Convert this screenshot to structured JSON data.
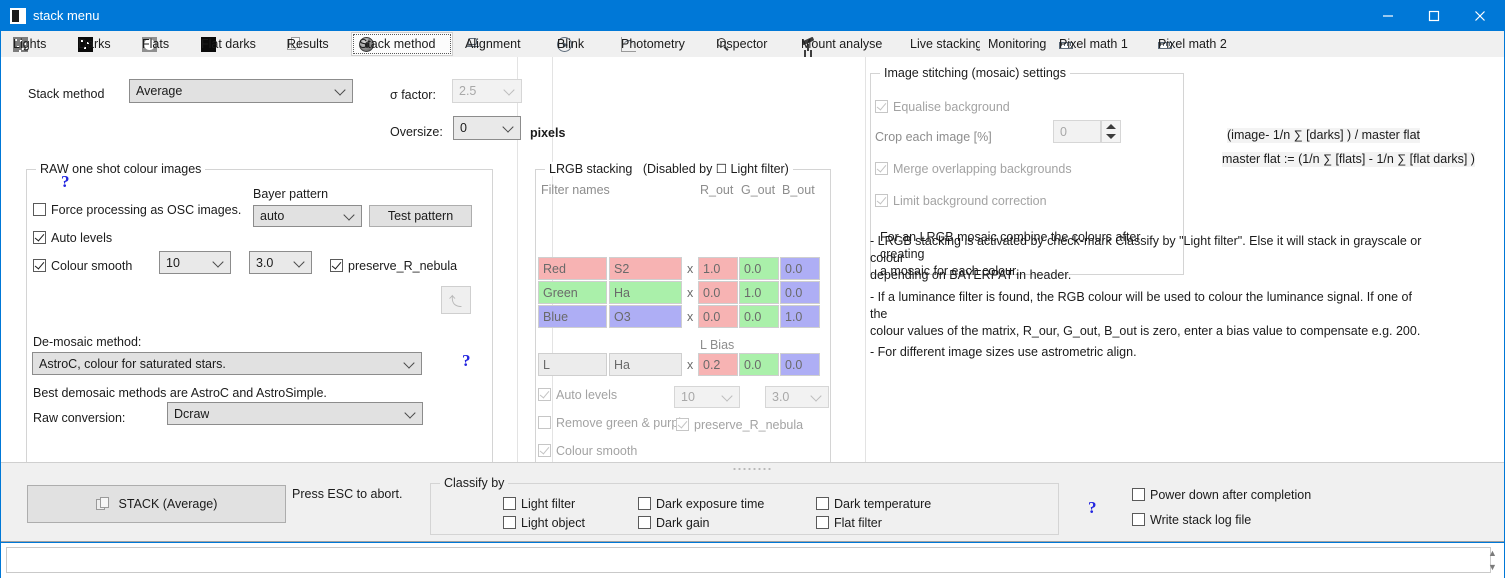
{
  "window": {
    "title": "stack menu",
    "minimize_label": "Minimize",
    "maximize_label": "Maximize",
    "close_label": "Close",
    "accent_color": "#0078d7"
  },
  "tabs": [
    {
      "label": "Lights",
      "icon": "lights-icon",
      "selected": false
    },
    {
      "label": "Darks",
      "icon": "darks-icon",
      "selected": false
    },
    {
      "label": "Flats",
      "icon": "flats-icon",
      "selected": false
    },
    {
      "label": "Flat darks",
      "icon": "flat-darks-icon",
      "selected": false
    },
    {
      "label": "Results",
      "icon": "results-icon",
      "selected": false
    },
    {
      "label": "Stack method",
      "icon": "stack-method-icon",
      "selected": true
    },
    {
      "label": "Alignment",
      "icon": "alignment-icon",
      "selected": false
    },
    {
      "label": "Blink",
      "icon": "blink-icon",
      "selected": false
    },
    {
      "label": "Photometry",
      "icon": "photometry-icon",
      "selected": false
    },
    {
      "label": "Inspector",
      "icon": "inspector-icon",
      "selected": false
    },
    {
      "label": "Mount analyse",
      "icon": "mount-analyse-icon",
      "selected": false
    },
    {
      "label": "Live stacking",
      "icon": "",
      "selected": false
    },
    {
      "label": "Monitoring",
      "icon": "",
      "selected": false
    },
    {
      "label": "Pixel math 1",
      "icon": "pixel-math-icon",
      "selected": false
    },
    {
      "label": "Pixel math 2",
      "icon": "pixel-math-icon",
      "selected": false
    }
  ],
  "stack_method": {
    "label": "Stack method",
    "value": "Average",
    "help": "?",
    "sigma_label": "σ factor:",
    "sigma_value": "2.5",
    "oversize_label": "Oversize:",
    "oversize_value": "0",
    "pixels_label": "pixels"
  },
  "raw_osc": {
    "title": "RAW one shot colour images",
    "force_osc_label": "Force processing as OSC images.",
    "force_osc_checked": false,
    "auto_levels_label": "Auto levels",
    "auto_levels_checked": true,
    "colour_smooth_label": "Colour smooth",
    "colour_smooth_checked": true,
    "colour_smooth_value1": "10",
    "colour_smooth_value2": "3.0",
    "preserve_label": "preserve_R_nebula",
    "preserve_checked": true,
    "bayer_label": "Bayer pattern",
    "bayer_value": "auto",
    "test_pattern_label": "Test pattern",
    "undo_label": "Undo",
    "demosaic_label": "De-mosaic method:",
    "demosaic_value": "AstroC, colour for saturated stars.",
    "demosaic_help": "?",
    "demosaic_note": "Best demosaic methods are AstroC and AstroSimple.",
    "raw_conversion_label": "Raw conversion:",
    "raw_conversion_value": "Dcraw"
  },
  "lrgb": {
    "title": "LRGB stacking",
    "title_suffix": "(Disabled by ☐ Light filter)",
    "filter_names_label": "Filter names",
    "col_r": "R_out",
    "col_g": "G_out",
    "col_b": "B_out",
    "x_symbol": "x",
    "l_bias_label": "L Bias",
    "rows": [
      {
        "name": "Red",
        "filter": "S2",
        "r": "1.0",
        "g": "0.0",
        "b": "0.0",
        "tone": "red"
      },
      {
        "name": "Green",
        "filter": "Ha",
        "r": "0.0",
        "g": "1.0",
        "b": "0.0",
        "tone": "green"
      },
      {
        "name": "Blue",
        "filter": "O3",
        "r": "0.0",
        "g": "0.0",
        "b": "1.0",
        "tone": "blue"
      }
    ],
    "l_row": {
      "name": "L",
      "filter": "Ha",
      "r": "0.2",
      "g": "0.0",
      "b": "0.0",
      "tone": "plain"
    },
    "auto_levels_label": "Auto levels",
    "auto_levels_checked": true,
    "remove_gp_label": "Remove green & purple",
    "remove_gp_checked": false,
    "colour_smooth_label": "Colour smooth",
    "colour_smooth_checked": true,
    "colour_smooth_value1": "10",
    "colour_smooth_value2": "3.0",
    "preserve_label": "preserve_R_nebula",
    "preserve_checked": true
  },
  "mosaic": {
    "title": "Image stitching (mosaic) settings",
    "equalise_label": "Equalise background",
    "equalise_checked": true,
    "crop_label": "Crop each image [%]",
    "crop_value": "0",
    "merge_label": "Merge overlapping backgrounds",
    "merge_checked": true,
    "limit_label": "Limit background correction",
    "limit_checked": true,
    "note": "For an LRGB mosaic combine the colours after creating\na mosaic for each colour."
  },
  "formulas": {
    "line1": "(image- 1/n ∑ [darks] ) / master flat",
    "line2": "master flat :=  (1/n ∑ [flats] - 1/n ∑ [flat darks] )"
  },
  "notes": {
    "bullet1": "- LRGB stacking is activated by check-mark Classify by \"Light filter\". Else it will stack in grayscale or colour\ndepending on BAYERPAT in header.",
    "bullet2": "- If a luminance filter is found, the RGB colour will be used to colour the luminance signal. If one of the\ncolour values of the matrix, R_our, G_out, B_out is zero, enter a bias value to compensate e.g. 200.",
    "bullet3": "- For different image sizes use astrometric align."
  },
  "bottom": {
    "stack_button_label": "STACK (Average)",
    "abort_hint": "Press ESC to abort.",
    "classify_title": "Classify by",
    "classify_items": [
      {
        "label": "Light filter",
        "checked": false
      },
      {
        "label": "Light object",
        "checked": false
      },
      {
        "label": "Dark exposure time",
        "checked": false
      },
      {
        "label": "Dark gain",
        "checked": false
      },
      {
        "label": "Dark temperature",
        "checked": false
      },
      {
        "label": "Flat filter",
        "checked": false
      }
    ],
    "help": "?",
    "power_down_label": "Power down after completion",
    "power_down_checked": false,
    "write_log_label": "Write stack log file",
    "write_log_checked": false
  }
}
